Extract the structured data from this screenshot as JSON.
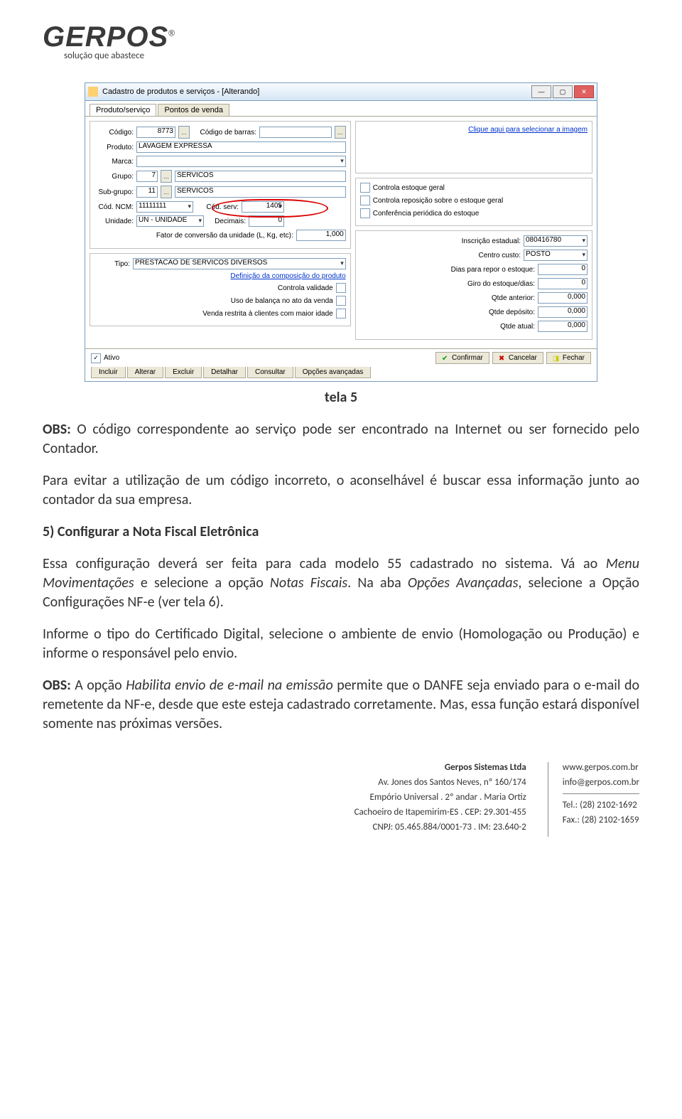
{
  "logo": {
    "main": "GERPOS",
    "sup": "®",
    "sub": "solução que abastece"
  },
  "screenshot": {
    "title": "Cadastro de produtos e serviços - [Alterando]",
    "tabs": [
      "Produto/serviço",
      "Pontos de venda"
    ],
    "left": {
      "codigo_label": "Código:",
      "codigo_value": "8773",
      "cod_barras_label": "Código de barras:",
      "cod_barras_value": "",
      "produto_label": "Produto:",
      "produto_value": "LAVAGEM EXPRESSA",
      "marca_label": "Marca:",
      "marca_value": "",
      "grupo_label": "Grupo:",
      "grupo_id": "7",
      "grupo_value": "SERVICOS",
      "subgrupo_label": "Sub-grupo:",
      "subgrupo_id": "11",
      "subgrupo_value": "SERVICOS",
      "ncm_label": "Cód. NCM:",
      "ncm_value": "11111111",
      "codserv_label": "Cód. serv:",
      "codserv_value": "1405",
      "unidade_label": "Unidade:",
      "unidade_value": "UN - UNIDADE",
      "decimais_label": "Decimais:",
      "decimais_value": "0",
      "fator_label": "Fator de conversão da unidade (L, Kg, etc):",
      "fator_value": "1,000",
      "tipo_label": "Tipo:",
      "tipo_value": "PRESTACAO DE SERVICOS DIVERSOS",
      "defcomp": "Definição da composição do produto",
      "validade": "Controla validade",
      "balanca": "Uso de balança no ato da venda",
      "restrita": "Venda restrita à clientes com maior idade"
    },
    "right": {
      "imglink": "Clique aqui para selecionar a imagem",
      "estoque_geral": "Controla estoque geral",
      "reposicao": "Controla reposição sobre o estoque geral",
      "conferencia": "Conferência periódica do estoque",
      "inscr_label": "Inscrição estadual:",
      "inscr_value": "080416780",
      "centro_label": "Centro custo:",
      "centro_value": "POSTO",
      "dias_label": "Dias para repor o estoque:",
      "dias_value": "0",
      "giro_label": "Giro do estoque/dias:",
      "giro_value": "0",
      "qtde_ant_label": "Qtde anterior:",
      "qtde_ant_value": "0,000",
      "qtde_dep_label": "Qtde depósito:",
      "qtde_dep_value": "0,000",
      "qtde_atual_label": "Qtde atual:",
      "qtde_atual_value": "0,000"
    },
    "bottom": {
      "ativo": "Ativo",
      "confirmar": "Confirmar",
      "cancelar": "Cancelar",
      "fechar": "Fechar",
      "tabs": [
        "Incluir",
        "Alterar",
        "Excluir",
        "Detalhar",
        "Consultar",
        "Opções avançadas"
      ]
    }
  },
  "caption": "tela 5",
  "text": {
    "p1a": "OBS:",
    "p1b": " O código correspondente ao serviço pode ser encontrado na Internet ou ser fornecido pelo Contador.",
    "p2": "Para evitar a utilização de um código incorreto, o aconselhável é buscar essa informação junto ao contador da sua empresa.",
    "h5": "5) Configurar a Nota Fiscal Eletrônica",
    "p3a": "Essa configuração deverá ser feita para cada modelo 55 cadastrado no sistema. Vá ao ",
    "p3b": "Menu Movimentações",
    "p3c": " e selecione a opção ",
    "p3d": "Notas Fiscais",
    "p3e": ". Na aba ",
    "p3f": "Opções Avançadas",
    "p3g": ", selecione a Opção Configurações NF-e (ver tela 6).",
    "p4": "Informe o tipo do Certificado Digital, selecione o ambiente de envio (Homologação ou Produção) e informe o responsável pelo envio.",
    "p5a": "OBS:",
    "p5b": " A opção ",
    "p5c": "Habilita envio de e-mail na emissão",
    "p5d": " permite que o DANFE seja enviado para o e-mail do remetente da NF-e, desde que este esteja cadastrado corretamente. Mas, essa função estará disponível somente nas próximas versões."
  },
  "footer": {
    "left": [
      "Gerpos Sistemas Ltda",
      "Av. Jones dos Santos Neves, nº 160/174",
      "Empório Universal . 2º andar . Maria Ortiz",
      "Cachoeiro de Itapemirim-ES . CEP: 29.301-455",
      "CNPJ: 05.465.884/0001-73 . IM: 23.640-2"
    ],
    "right": [
      "www.gerpos.com.br",
      "info@gerpos.com.br",
      "Tel.: (28) 2102-1692",
      "Fax.: (28) 2102-1659"
    ]
  }
}
